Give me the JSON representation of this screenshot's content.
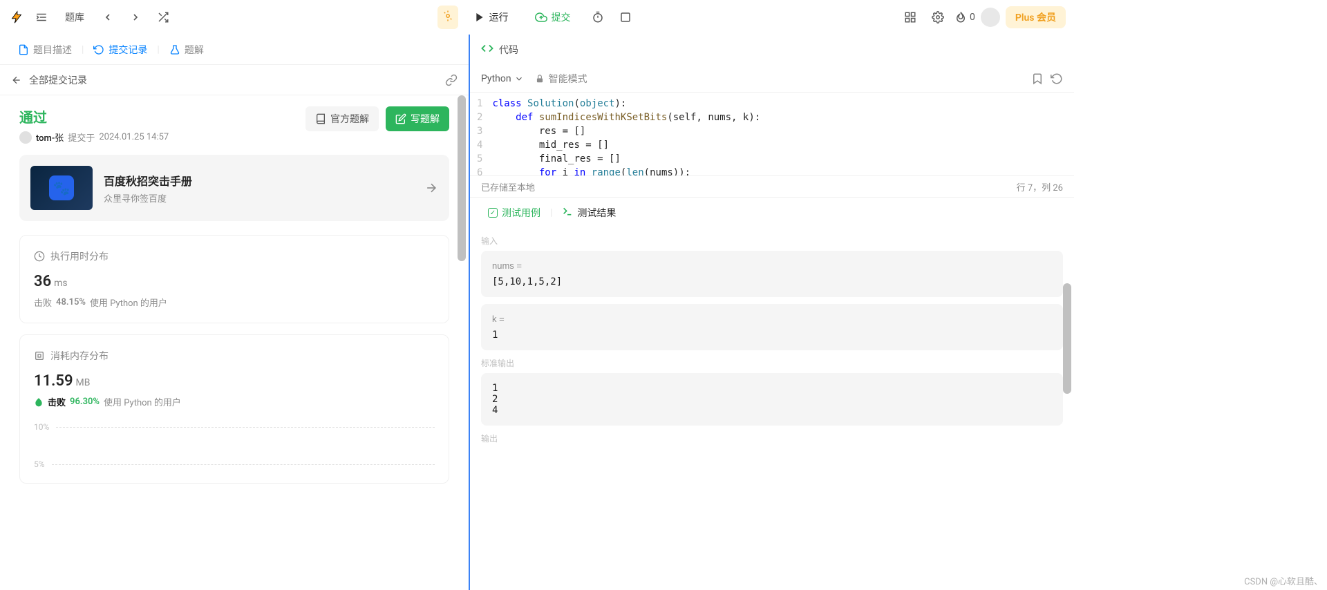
{
  "topbar": {
    "library": "题库",
    "run": "运行",
    "submit": "提交",
    "fire_count": "0",
    "plus": "Plus 会员"
  },
  "leftTabs": {
    "desc": "题目描述",
    "submissions": "提交记录",
    "solution": "题解"
  },
  "subHeader": {
    "all": "全部提交记录"
  },
  "submission": {
    "status": "通过",
    "user": "tom-张",
    "meta_prefix": "提交于",
    "time": "2024.01.25 14:57",
    "official": "官方题解",
    "write": "写题解"
  },
  "promo": {
    "title": "百度秋招突击手册",
    "sub": "众里寻你签百度"
  },
  "runtime": {
    "title": "执行用时分布",
    "value": "36",
    "unit": "ms",
    "beat_prefix": "击败",
    "beat_pct": "48.15%",
    "beat_suffix": "使用 Python 的用户"
  },
  "memory": {
    "title": "消耗内存分布",
    "value": "11.59",
    "unit": "MB",
    "beat_prefix": "击败",
    "beat_pct": "96.30%",
    "beat_suffix": "使用 Python 的用户",
    "tick10": "10%",
    "tick5": "5%"
  },
  "code": {
    "header": "代码",
    "lang": "Python",
    "mode": "智能模式",
    "saved": "已存储至本地",
    "cursor": "行 7，列 26",
    "lines": {
      "l1": "1",
      "l2": "2",
      "l3": "3",
      "l4": "4",
      "l5": "5",
      "l6": "6"
    }
  },
  "lowerTabs": {
    "cases": "测试用例",
    "result": "测试结果"
  },
  "testcase": {
    "input_lbl": "输入",
    "nums_key": "nums =",
    "nums_val": "[5,10,1,5,2]",
    "k_key": "k =",
    "k_val": "1",
    "stdout_lbl": "标准输出",
    "stdout_val": "1\n2\n4",
    "output_lbl": "输出"
  },
  "watermark": "CSDN @心软且酷、"
}
